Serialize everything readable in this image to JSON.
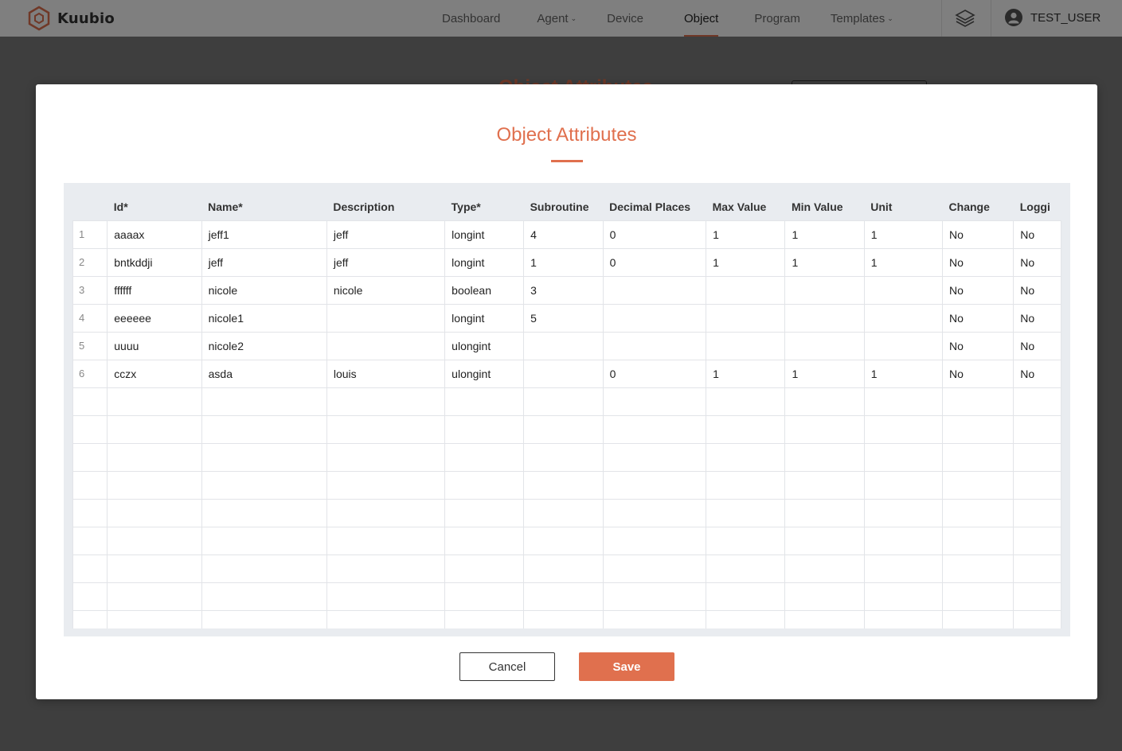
{
  "nav": {
    "brand": "Kuubio",
    "links": [
      "Dashboard",
      "Agent",
      "Device",
      "Object",
      "Program",
      "Templates"
    ],
    "active": "Object",
    "user": "TEST_USER"
  },
  "background": {
    "title": "Object Attributes"
  },
  "modal": {
    "title": "Object Attributes",
    "cancel_label": "Cancel",
    "save_label": "Save",
    "columns": [
      "",
      "Id*",
      "Name*",
      "Description",
      "Type*",
      "Subroutine",
      "Decimal Places",
      "Max Value",
      "Min Value",
      "Unit",
      "Change",
      "Loggi"
    ],
    "rows": [
      [
        "1",
        "aaaax",
        "jeff1",
        "jeff",
        "longint",
        "4",
        "0",
        "1",
        "1",
        "1",
        "No",
        "No"
      ],
      [
        "2",
        "bntkddji",
        "jeff",
        "jeff",
        "longint",
        "1",
        "0",
        "1",
        "1",
        "1",
        "No",
        "No"
      ],
      [
        "3",
        "ffffff",
        "nicole",
        "nicole",
        "boolean",
        "3",
        "",
        "",
        "",
        "",
        "No",
        "No"
      ],
      [
        "4",
        "eeeeee",
        "nicole1",
        "",
        "longint",
        "5",
        "",
        "",
        "",
        "",
        "No",
        "No"
      ],
      [
        "5",
        "uuuu",
        "nicole2",
        "",
        "ulongint",
        "",
        "",
        "",
        "",
        "",
        "No",
        "No"
      ],
      [
        "6",
        "cczx",
        "asda",
        "louis",
        "ulongint",
        "",
        "0",
        "1",
        "1",
        "1",
        "No",
        "No"
      ]
    ]
  },
  "colors": {
    "accent": "#e0704e",
    "grid_bg": "#e9ecf0"
  }
}
